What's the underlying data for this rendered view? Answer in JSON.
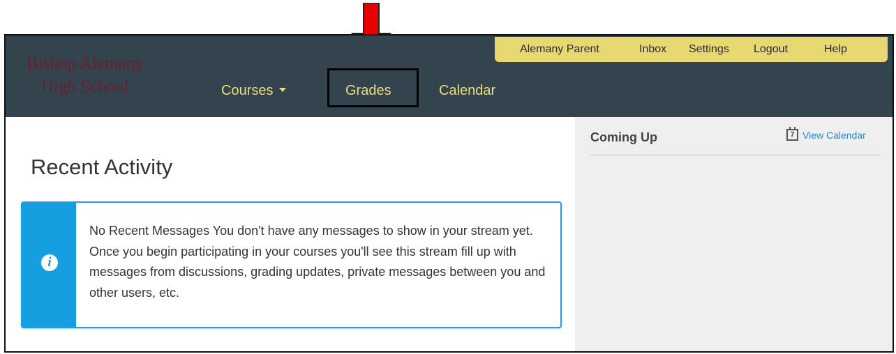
{
  "header": {
    "school_name_line1": "Bishop Alemany",
    "school_name_line2": "High School",
    "utility_links": [
      "Alemany Parent",
      "Inbox",
      "Settings",
      "Logout",
      "Help"
    ],
    "nav": {
      "courses": "Courses",
      "grades": "Grades",
      "calendar": "Calendar"
    }
  },
  "main": {
    "title": "Recent Activity",
    "alert_text": "No Recent Messages  You don't have any messages to show in your stream yet. Once you begin participating in your courses you'll see this stream fill up with messages from discussions, grading updates, private messages between you and other users, etc.",
    "alert_icon": "i"
  },
  "sidebar": {
    "title": "Coming Up",
    "view_calendar": "View Calendar",
    "calendar_icon_day": "7"
  },
  "colors": {
    "header_bg": "#34444f",
    "nav_text": "#ecdc7e",
    "utility_bg": "#e8d872",
    "logo_text": "#6b1f2e",
    "alert_accent": "#159ee0",
    "annotation_arrow": "#e60000"
  }
}
